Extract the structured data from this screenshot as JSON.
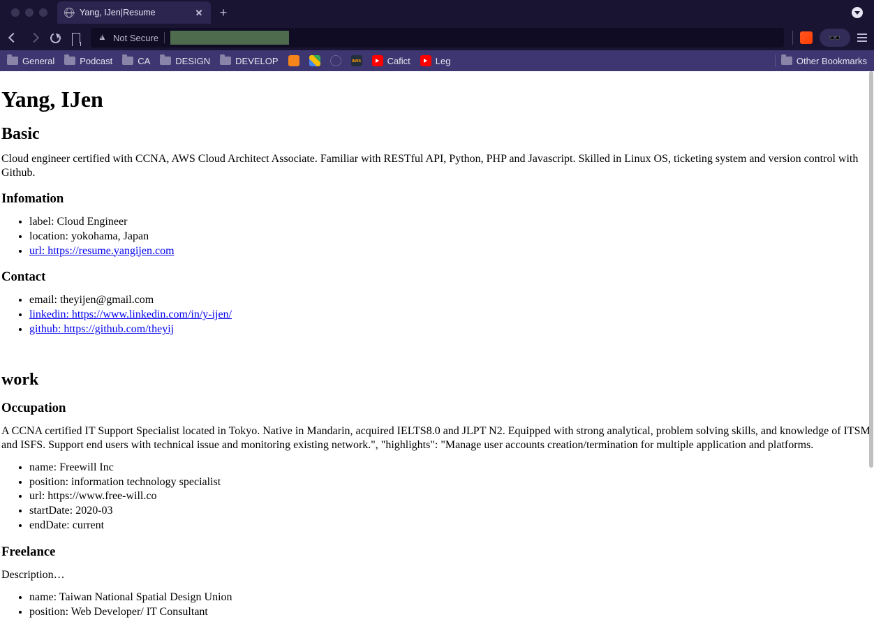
{
  "tab": {
    "title": "Yang, IJen|Resume"
  },
  "addressBar": {
    "notSecure": "Not Secure"
  },
  "bookmarks": {
    "items": [
      "General",
      "Podcast",
      "CA",
      "DESIGN",
      "DEVELOP"
    ],
    "favicons": [
      {
        "name": "metamask",
        "bg": "#f6851b"
      },
      {
        "name": "drive",
        "bg": "linear-gradient(45deg,#4285f4,#fbbc05,#34a853)"
      },
      {
        "name": "crescent",
        "bg": "#3d3670"
      },
      {
        "name": "aws",
        "label": "aws"
      },
      {
        "name": "youtube"
      }
    ],
    "textItems": [
      "Cafict",
      "Leg"
    ],
    "other": "Other Bookmarks"
  },
  "resume": {
    "name": "Yang, IJen",
    "basic": {
      "heading": "Basic",
      "summary": "Cloud engineer certified with CCNA, AWS Cloud Architect Associate. Familiar with RESTful API, Python, PHP and Javascript. Skilled in Linux OS, ticketing system and version control with Github."
    },
    "information": {
      "heading": "Infomation",
      "label": "label: Cloud Engineer",
      "location": "location: yokohama, Japan",
      "url": "url: https://resume.yangijen.com"
    },
    "contact": {
      "heading": "Contact",
      "email": "email: theyijen@gmail.com",
      "linkedin": "linkedin: https://www.linkedin.com/in/y-ijen/",
      "github": "github: https://github.com/theyij"
    },
    "work": {
      "heading": "work",
      "occupation": {
        "heading": "Occupation",
        "summary": "A CCNA certified IT Support Specialist located in Tokyo. Native in Mandarin, acquired IELTS8.0 and JLPT N2. Equipped with strong analytical, problem solving skills, and knowledge of ITSM and ISFS. Support end users with technical issue and monitoring existing network.\", \"highlights\": \"Manage user accounts creation/termination for multiple application and platforms.",
        "items": {
          "name": "name: Freewill Inc",
          "position": "position: information technology specialist",
          "url": "url: https://www.free-will.co",
          "startDate": "startDate: 2020-03",
          "endDate": "endDate: current"
        }
      },
      "freelance": {
        "heading": "Freelance",
        "description": "Description…",
        "items": {
          "name": "name: Taiwan National Spatial Design Union",
          "position": "position: Web Developer/ IT Consultant"
        }
      }
    }
  }
}
